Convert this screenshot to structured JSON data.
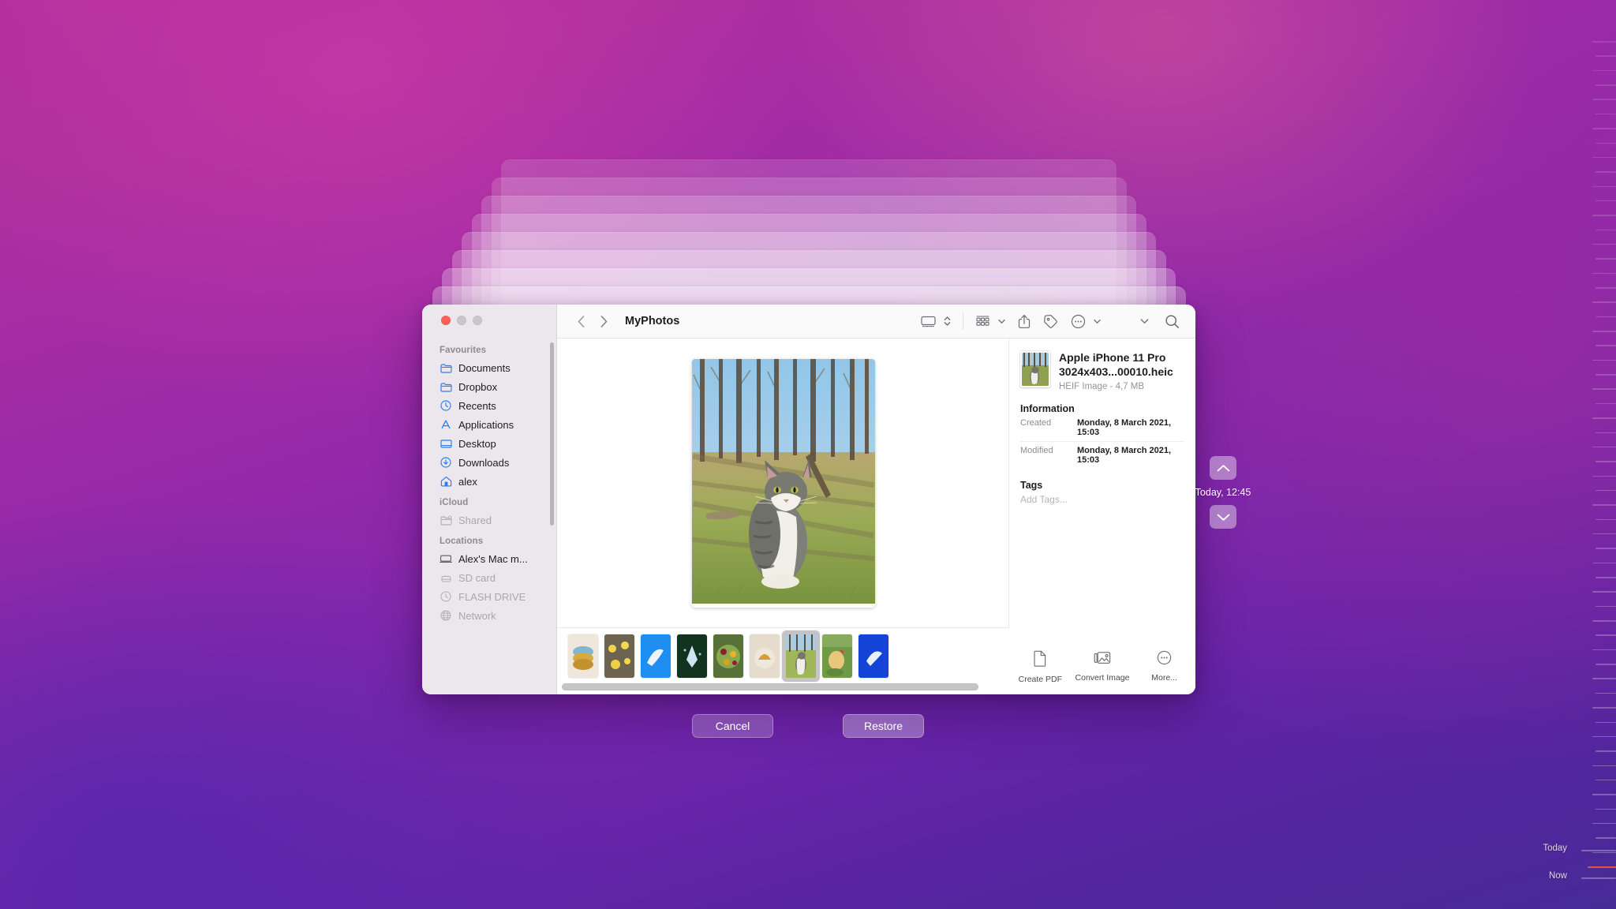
{
  "desktop": {
    "background_colors": {
      "top_left_magenta": "#b4309e",
      "mid_purple": "#8e28ab",
      "bottom_indigo": "#472a97"
    }
  },
  "stacked_windows": {
    "count": 8
  },
  "window": {
    "title": "MyPhotos",
    "traffic_lights": [
      {
        "name": "close",
        "color": "#ff5f57",
        "enabled": true
      },
      {
        "name": "minimize",
        "color": "#c9c6ca",
        "enabled": false
      },
      {
        "name": "maximize",
        "color": "#c9c6ca",
        "enabled": false
      }
    ]
  },
  "toolbar": {
    "back_icon": "chevron-left-icon",
    "forward_icon": "chevron-right-icon",
    "title": "MyPhotos",
    "buttons": [
      {
        "icon": "view-mode-icon",
        "has_caret": true
      },
      {
        "icon": "group-by-icon",
        "has_caret": true
      },
      {
        "icon": "share-icon",
        "has_caret": false
      },
      {
        "icon": "tag-icon",
        "has_caret": false
      },
      {
        "icon": "more-actions-icon",
        "has_caret": true
      },
      {
        "icon": "overflow-caret-icon",
        "has_caret": false
      },
      {
        "icon": "search-icon",
        "has_caret": false
      }
    ]
  },
  "sidebar": {
    "groups": [
      {
        "title": "Favourites",
        "items": [
          {
            "label": "Documents",
            "icon": "folder-icon",
            "dim": false
          },
          {
            "label": "Dropbox",
            "icon": "folder-icon",
            "dim": false
          },
          {
            "label": "Recents",
            "icon": "clock-icon",
            "dim": false
          },
          {
            "label": "Applications",
            "icon": "app-store-icon",
            "dim": false
          },
          {
            "label": "Desktop",
            "icon": "desktop-icon",
            "dim": false
          },
          {
            "label": "Downloads",
            "icon": "download-icon",
            "dim": false
          },
          {
            "label": "alex",
            "icon": "home-icon",
            "dim": false
          }
        ]
      },
      {
        "title": "iCloud",
        "items": [
          {
            "label": "Shared",
            "icon": "shared-folder-icon",
            "dim": true
          }
        ]
      },
      {
        "title": "Locations",
        "items": [
          {
            "label": "Alex's Mac m...",
            "icon": "laptop-icon",
            "dim": false
          },
          {
            "label": "SD card",
            "icon": "sd-card-icon",
            "dim": true
          },
          {
            "label": "FLASH DRIVE",
            "icon": "flash-drive-icon",
            "dim": true
          },
          {
            "label": "Network",
            "icon": "network-icon",
            "dim": true
          }
        ]
      }
    ]
  },
  "preview": {
    "image_alt": "tabby and white cat sitting in sunlit bare-tree forest"
  },
  "filmstrip": {
    "selected_index": 6,
    "thumbnails": [
      {
        "alt": "stacked blue and yellow macarons"
      },
      {
        "alt": "yellow daffodils in woodland"
      },
      {
        "alt": "white bird flying on blue background"
      },
      {
        "alt": "white flower glowing at night"
      },
      {
        "alt": "colourful salad bowl with mango"
      },
      {
        "alt": "pumpkin slice on beige plate"
      },
      {
        "alt": "cat sitting in forest clearing"
      },
      {
        "alt": "chicken in green garden"
      },
      {
        "alt": "bird on deep blue background"
      }
    ],
    "scrollbar_visible": true
  },
  "inspector": {
    "filename_line1": "Apple iPhone 11 Pro",
    "filename_line2": "3024x403...00010.heic",
    "kind_and_size": "HEIF Image - 4,7 MB",
    "information_heading": "Information",
    "rows": [
      {
        "key": "Created",
        "value": "Monday, 8 March 2021, 15:03"
      },
      {
        "key": "Modified",
        "value": "Monday, 8 March 2021, 15:03"
      }
    ],
    "tags_heading": "Tags",
    "tags_placeholder": "Add Tags..."
  },
  "quick_actions": [
    {
      "label": "Create PDF",
      "icon": "document-icon"
    },
    {
      "label": "Convert Image",
      "icon": "convert-image-icon"
    },
    {
      "label": "More...",
      "icon": "more-circle-icon"
    }
  ],
  "action_bar": {
    "cancel_label": "Cancel",
    "restore_label": "Restore"
  },
  "time_navigator": {
    "up_icon": "chevron-up-icon",
    "down_icon": "chevron-down-icon",
    "timestamp": "Today, 12:45"
  },
  "timeline": {
    "today_label": "Today",
    "now_label": "Now",
    "now_tick_color": "#f2502a"
  }
}
